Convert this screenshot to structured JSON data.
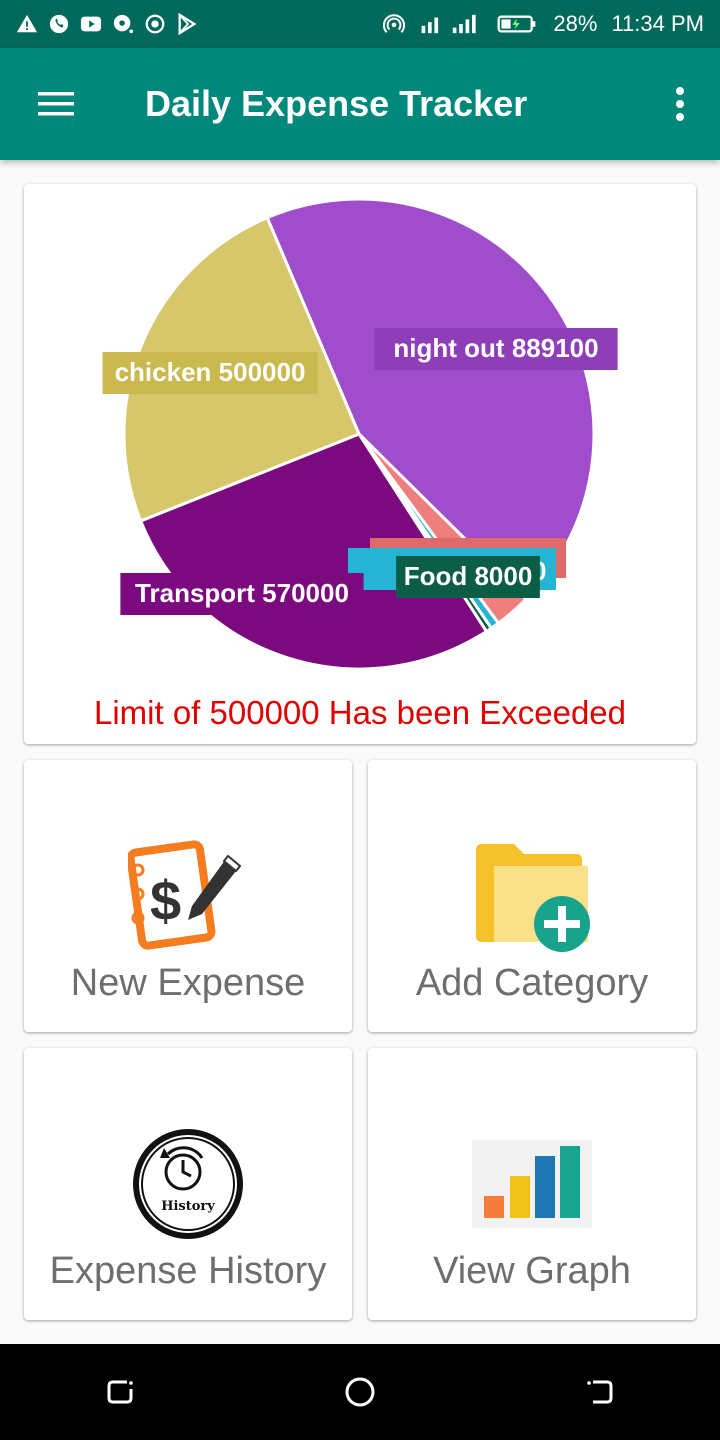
{
  "status_bar": {
    "battery": "28%",
    "time": "11:34 PM",
    "icons": [
      "alert-icon",
      "whatsapp-icon",
      "youtube-icon",
      "chat-icon",
      "record-icon",
      "play-store-icon",
      "hotspot-icon",
      "signal-icon",
      "battery-icon"
    ]
  },
  "app_bar": {
    "title": "Daily Expense Tracker",
    "menu_icon": "menu-icon",
    "overflow_icon": "more-vert-icon",
    "color": "#00897b"
  },
  "chart_data": {
    "type": "pie",
    "slices": [
      {
        "label": "night out 889100",
        "name": "night out",
        "value": 889100,
        "color": "#a04dcb"
      },
      {
        "label": "",
        "name": "",
        "value": 50000,
        "color": "#ef7f7f"
      },
      {
        "label": "",
        "name": "",
        "value": 12000,
        "color": "#26b4d4"
      },
      {
        "label": "Food 8000",
        "name": "Food",
        "value": 8000,
        "color": "#0b5e45"
      },
      {
        "label": "Transport 570000",
        "name": "Transport",
        "value": 570000,
        "color": "#7a0a7d"
      },
      {
        "label": "chicken 500000",
        "name": "chicken",
        "value": 500000,
        "color": "#d6c76a"
      }
    ],
    "visible_labels": {
      "overlap_fragment_1": "00",
      "overlap_fragment_2": "Food 8000"
    }
  },
  "limit_message": "Limit of 500000 Has been Exceeded",
  "tiles": [
    {
      "label": "New Expense",
      "icon": "new-expense-icon"
    },
    {
      "label": "Add Category",
      "icon": "add-category-icon"
    },
    {
      "label": "Expense History",
      "icon": "history-icon"
    },
    {
      "label": "View Graph",
      "icon": "bar-graph-icon"
    }
  ],
  "history_icon_text": "History",
  "nav_bar": {
    "icons": [
      "recent-apps-icon",
      "home-icon",
      "back-icon"
    ]
  }
}
